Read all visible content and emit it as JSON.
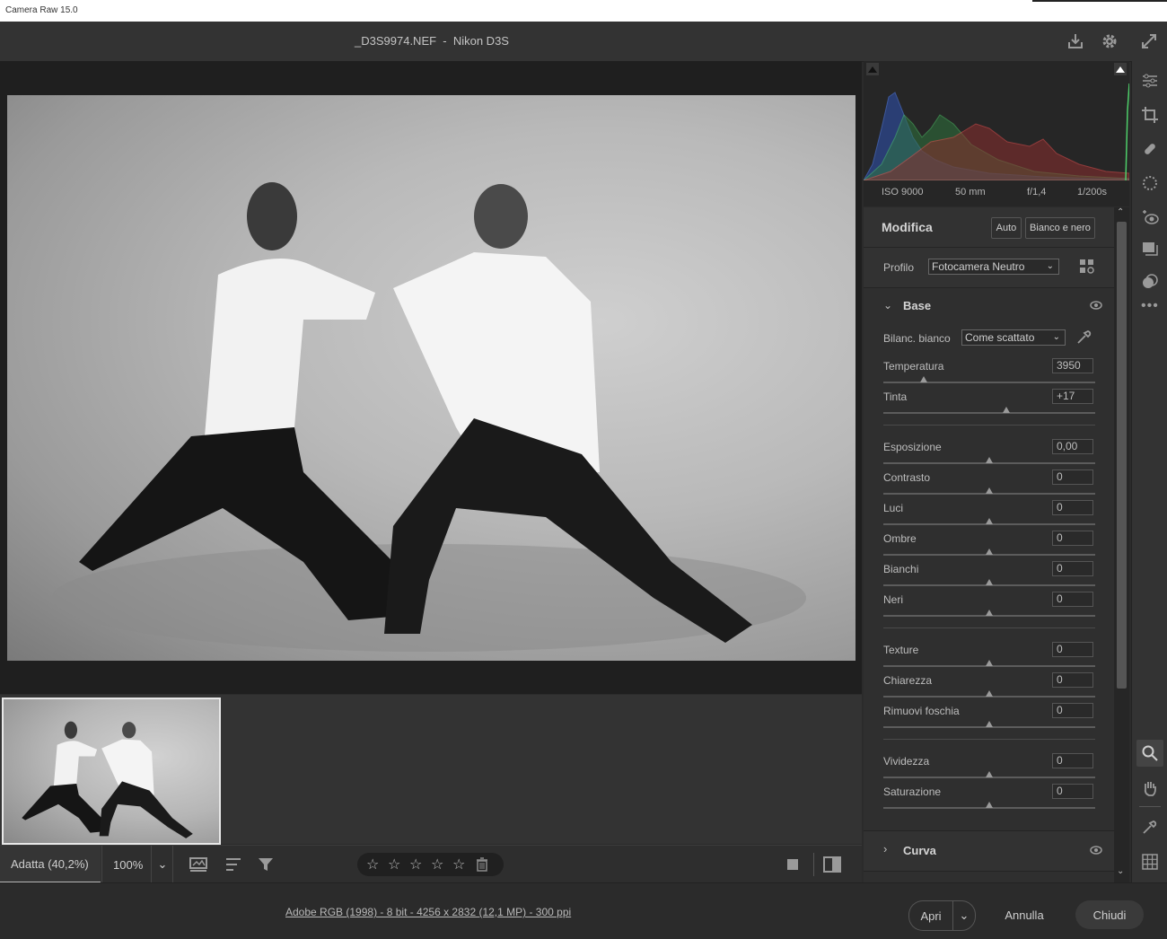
{
  "app": {
    "title": "Camera Raw 15.0"
  },
  "header": {
    "file_title": "_D3S9974.NEF  -  Nikon D3S"
  },
  "exif": {
    "iso": "ISO 9000",
    "focal": "50 mm",
    "aperture": "f/1,4",
    "shutter": "1/200s"
  },
  "edit": {
    "title": "Modifica",
    "auto_label": "Auto",
    "bw_label": "Bianco e nero",
    "profile_label": "Profilo",
    "profile_value": "Fotocamera Neutro"
  },
  "base": {
    "title": "Base",
    "wb_label": "Bilanc. bianco",
    "wb_value": "Come scattato",
    "sliders": [
      {
        "label": "Temperatura",
        "value": "3950",
        "pos": 0.19
      },
      {
        "label": "Tinta",
        "value": "+17",
        "pos": 0.58
      },
      {
        "label": "Esposizione",
        "value": "0,00",
        "pos": 0.5
      },
      {
        "label": "Contrasto",
        "value": "0",
        "pos": 0.5
      },
      {
        "label": "Luci",
        "value": "0",
        "pos": 0.5
      },
      {
        "label": "Ombre",
        "value": "0",
        "pos": 0.5
      },
      {
        "label": "Bianchi",
        "value": "0",
        "pos": 0.5
      },
      {
        "label": "Neri",
        "value": "0",
        "pos": 0.5
      },
      {
        "label": "Texture",
        "value": "0",
        "pos": 0.5
      },
      {
        "label": "Chiarezza",
        "value": "0",
        "pos": 0.5
      },
      {
        "label": "Rimuovi foschia",
        "value": "0",
        "pos": 0.5
      },
      {
        "label": "Vividezza",
        "value": "0",
        "pos": 0.5
      },
      {
        "label": "Saturazione",
        "value": "0",
        "pos": 0.5
      }
    ]
  },
  "curve": {
    "title": "Curva"
  },
  "toolbar": {
    "zoom_fit": "Adatta (40,2%)",
    "zoom_100": "100%"
  },
  "footer": {
    "info": "Adobe RGB (1998) - 8 bit - 4256 x 2832 (12,1 MP) - 300 ppi",
    "open_label": "Apri",
    "cancel_label": "Annulla",
    "close_label": "Chiudi"
  },
  "colors": {
    "panel_bg": "#2f2f2f",
    "canvas_bg": "#1f1f1f",
    "accent": "#cfcfcf"
  }
}
